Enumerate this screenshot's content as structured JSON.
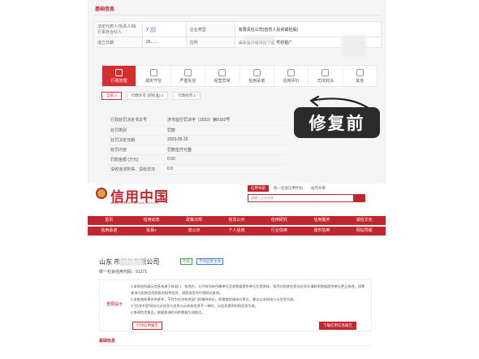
{
  "top": {
    "section_title": "基础信息",
    "info": {
      "legal_rep_label": "法定代表人/负责人/执行事务合伙人",
      "legal_rep_value": "Y",
      "company_type_label": "企业类型",
      "company_type_value": "有限责任公司(自然人投资或控股)",
      "est_date_label": "成立日期",
      "address_label": "住所",
      "address_value": "山东省济南市历下区\n号初祖广",
      "est_value": "20……"
    },
    "tabs": [
      {
        "label": "行政管理"
      },
      {
        "label": "诚实守信"
      },
      {
        "label": "严重失信"
      },
      {
        "label": "经营异常"
      },
      {
        "label": "信用承诺"
      },
      {
        "label": "信用评价"
      },
      {
        "label": "司法判决"
      },
      {
        "label": "其他"
      }
    ],
    "filter": {
      "all": "全部",
      "all_count": "4",
      "chip1": "行政许可 (新标准)",
      "chip1_count": "2",
      "chip2": "行政处罚",
      "chip2_count": "1"
    },
    "fix_label": "修复前",
    "detail": [
      {
        "k": "行政处罚决定书文号",
        "v": "济市监行罚决字〔2023〕第0162号"
      },
      {
        "k": "处罚类别",
        "v": "罚款"
      },
      {
        "k": "处罚决定日期",
        "v": "2023-05-15"
      },
      {
        "k": "处罚内容",
        "v": "罚款伍仟元整"
      },
      {
        "k": "罚款金额 (万元)",
        "v": "0.50"
      },
      {
        "k": "没收违法所得、没收非法",
        "v": "0.0"
      }
    ]
  },
  "bottom": {
    "logo": "信用中国",
    "logo_sub": "WWW.CREDITCHINA.GOV.CN",
    "header_tabs": [
      "信用导航",
      "统一社会信用代码",
      "站内文章"
    ],
    "search_placeholder": "请输入企业名称",
    "nav1": [
      "首页",
      "信用动态",
      "政策法规",
      "信息公示",
      "信用研究",
      "信用服务",
      "诚信文化"
    ],
    "nav2": [
      "信用承诺",
      "信易+",
      "双公示",
      "个人信用",
      "行业信用",
      "城市信用",
      "网站导航"
    ],
    "company": "山东        市服务有限公司",
    "badge_status": "存续",
    "badge_type": "市场监管主体",
    "ucode": "统一社会信用代码：91371",
    "notice_label": "重要提示",
    "notice_lines": [
      "1.本网站所展示信息来源于各部门、各地方，公开前均有所属单位及其数据提供单位负责审核，如您对相关信息存在异议请联系数据提供单位更正修改，如需查询与相关信用修复的相关信息，请登录信用中国网站查询。",
      "2.本查询结果仅供参考，不作为任何有关部门的最终结论。如需使用请核对原文，建议以本网站公示信息为准。",
      "3.“信用中国”网站公示信息与信息公示机构信息不一致时，以信息提供机构信息为准。",
      "4.查询信用报告，依据查询时间的数据生成报告。"
    ],
    "print_btn": "打印信用报告",
    "download_btn": "下载信用信息报告",
    "base_title": "基础信息"
  }
}
